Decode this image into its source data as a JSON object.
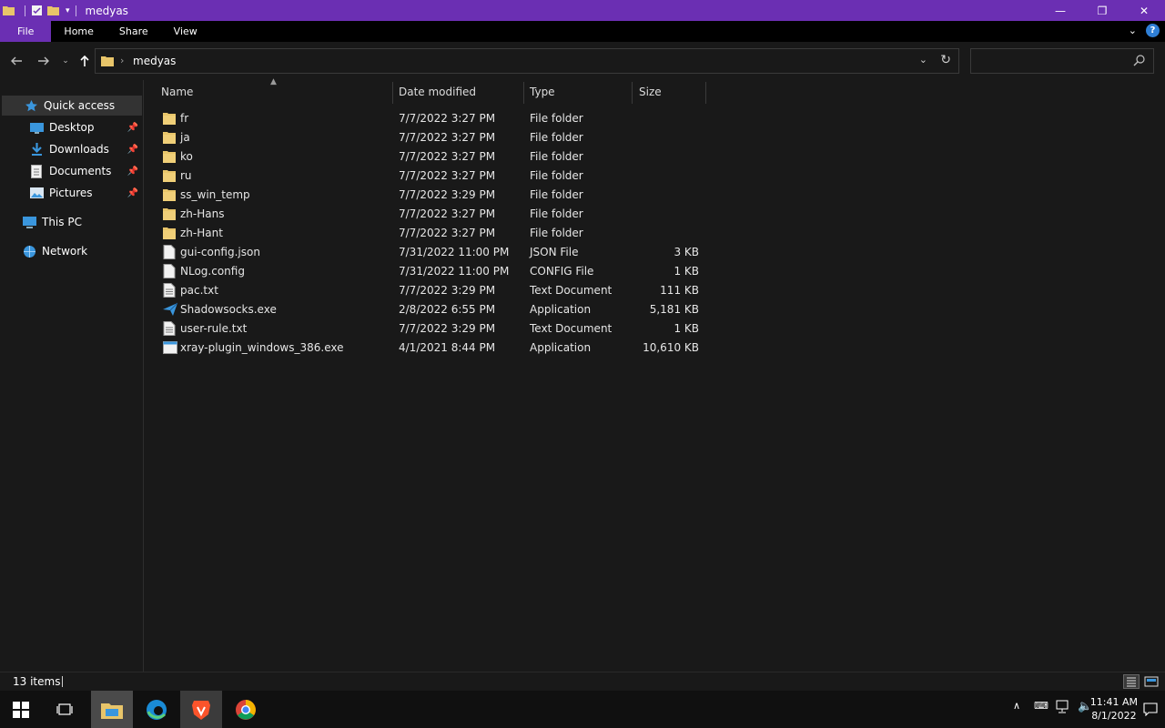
{
  "window": {
    "title": "medyas",
    "controls": {
      "minimize": "—",
      "maximize": "❐",
      "close": "✕"
    }
  },
  "ribbon": {
    "tabs": [
      "File",
      "Home",
      "Share",
      "View"
    ],
    "help": "?"
  },
  "address": {
    "crumb": "medyas",
    "search_placeholder": ""
  },
  "sidebar": {
    "items": [
      {
        "label": "Quick access",
        "icon": "star-icon",
        "pinned": false
      },
      {
        "label": "Desktop",
        "icon": "desktop-icon",
        "pinned": true
      },
      {
        "label": "Downloads",
        "icon": "download-icon",
        "pinned": true
      },
      {
        "label": "Documents",
        "icon": "documents-icon",
        "pinned": true
      },
      {
        "label": "Pictures",
        "icon": "pictures-icon",
        "pinned": true
      },
      {
        "label": "This PC",
        "icon": "pc-icon",
        "pinned": false
      },
      {
        "label": "Network",
        "icon": "network-icon",
        "pinned": false
      }
    ]
  },
  "columns": [
    "Name",
    "Date modified",
    "Type",
    "Size"
  ],
  "files": [
    {
      "name": "fr",
      "date": "7/7/2022 3:27 PM",
      "type": "File folder",
      "size": "",
      "icon": "folder-icon"
    },
    {
      "name": "ja",
      "date": "7/7/2022 3:27 PM",
      "type": "File folder",
      "size": "",
      "icon": "folder-icon"
    },
    {
      "name": "ko",
      "date": "7/7/2022 3:27 PM",
      "type": "File folder",
      "size": "",
      "icon": "folder-icon"
    },
    {
      "name": "ru",
      "date": "7/7/2022 3:27 PM",
      "type": "File folder",
      "size": "",
      "icon": "folder-icon"
    },
    {
      "name": "ss_win_temp",
      "date": "7/7/2022 3:29 PM",
      "type": "File folder",
      "size": "",
      "icon": "folder-icon"
    },
    {
      "name": "zh-Hans",
      "date": "7/7/2022 3:27 PM",
      "type": "File folder",
      "size": "",
      "icon": "folder-icon"
    },
    {
      "name": "zh-Hant",
      "date": "7/7/2022 3:27 PM",
      "type": "File folder",
      "size": "",
      "icon": "folder-icon"
    },
    {
      "name": "gui-config.json",
      "date": "7/31/2022 11:00 PM",
      "type": "JSON File",
      "size": "3 KB",
      "icon": "file-icon"
    },
    {
      "name": "NLog.config",
      "date": "7/31/2022 11:00 PM",
      "type": "CONFIG File",
      "size": "1 KB",
      "icon": "file-icon"
    },
    {
      "name": "pac.txt",
      "date": "7/7/2022 3:29 PM",
      "type": "Text Document",
      "size": "111 KB",
      "icon": "text-file-icon"
    },
    {
      "name": "Shadowsocks.exe",
      "date": "2/8/2022 6:55 PM",
      "type": "Application",
      "size": "5,181 KB",
      "icon": "paper-plane-icon"
    },
    {
      "name": "user-rule.txt",
      "date": "7/7/2022 3:29 PM",
      "type": "Text Document",
      "size": "1 KB",
      "icon": "text-file-icon"
    },
    {
      "name": "xray-plugin_windows_386.exe",
      "date": "4/1/2021 8:44 PM",
      "type": "Application",
      "size": "10,610 KB",
      "icon": "app-window-icon"
    }
  ],
  "status": {
    "count": "13 items"
  },
  "taskbar": {
    "time": "11:41 AM",
    "date": "8/1/2022",
    "apps": [
      "file-explorer-icon",
      "edge-icon",
      "brave-icon",
      "chrome-icon"
    ]
  },
  "colors": {
    "accent": "#6b2fb3",
    "folder": "#e8c56a",
    "background": "#191919"
  }
}
